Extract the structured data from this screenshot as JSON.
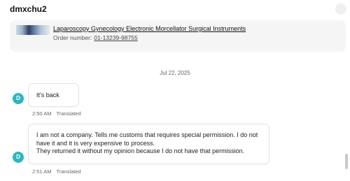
{
  "header": {
    "username": "dmxchu2"
  },
  "order": {
    "title": "Laparoscopy Gynecology Electronic Morcellator Surgical Instruments",
    "number_label": "Order number:",
    "number": "01-13239-98755"
  },
  "date_separator": "Jul 22, 2025",
  "messages": [
    {
      "avatar": "D",
      "lines": [
        "It's back"
      ],
      "time": "2:50 AM",
      "status": "Translated"
    },
    {
      "avatar": "D",
      "lines": [
        "I am not a company. Tells me customs that requires special permission. I do not",
        "have it and it is very expensive to process.",
        "They returned it without my opinion because I do not have that permission."
      ],
      "time": "2:51 AM",
      "status": "Translated"
    }
  ]
}
